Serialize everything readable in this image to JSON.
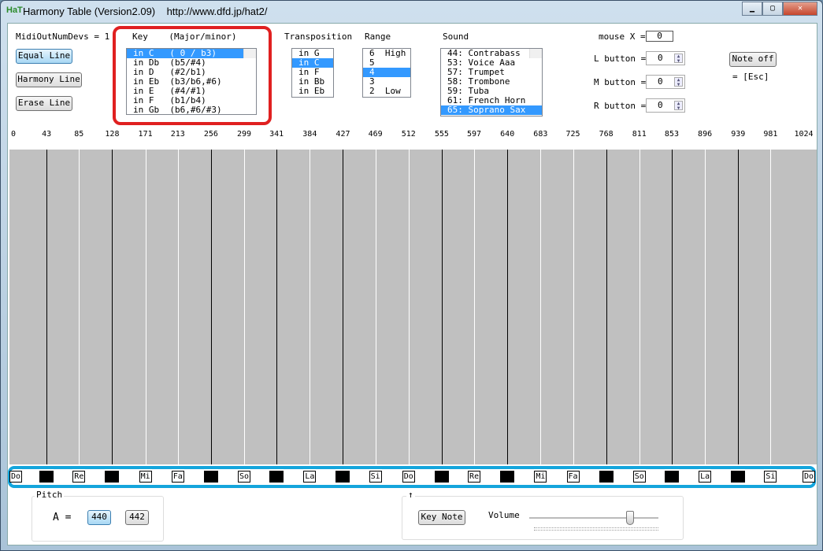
{
  "window": {
    "title": "Harmony Table (Version2.09)    http://www.dfd.jp/hat2/",
    "icon": "HaT"
  },
  "midi": {
    "label": "MidiOutNumDevs = 1"
  },
  "buttons": {
    "equal_line": "Equal Line",
    "harmony_line": "Harmony Line",
    "erase_line": "Erase Line",
    "note_off": "Note off",
    "esc": "= [Esc]",
    "key_note": "Key Note"
  },
  "key": {
    "label": "Key    (Major/minor)",
    "items": [
      "in C   ( 0 / b3)",
      "in Db  (b5/#4)",
      "in D   (#2/b1)",
      "in Eb  (b3/b6,#6)",
      "in E   (#4/#1)",
      "in F   (b1/b4)",
      "in Gb  (b6,#6/#3)"
    ],
    "selected": 0
  },
  "transposition": {
    "label": "Transposition",
    "items": [
      "in G",
      "in C",
      "in F",
      "in Bb",
      "in Eb"
    ],
    "selected": 1
  },
  "range": {
    "label": "Range",
    "items": [
      "6  High",
      "5",
      "4",
      "3",
      "2  Low"
    ],
    "selected": 2
  },
  "sound": {
    "label": "Sound",
    "items": [
      "44: Contrabass",
      "53: Voice Aaa",
      "57: Trumpet",
      "58: Trombone",
      "59: Tuba",
      "61: French Horn",
      "65: Soprano Sax"
    ],
    "selected": 6
  },
  "mouse": {
    "x_label": "mouse X =",
    "x_value": "0",
    "l_label": "L button =",
    "l_value": "0",
    "m_label": "M button =",
    "m_value": "0",
    "r_label": "R button =",
    "r_value": "0"
  },
  "ticks": [
    "0",
    "43",
    "85",
    "128",
    "171",
    "213",
    "256",
    "299",
    "341",
    "384",
    "427",
    "469",
    "512",
    "555",
    "597",
    "640",
    "683",
    "725",
    "768",
    "811",
    "853",
    "896",
    "939",
    "981",
    "1024"
  ],
  "notes": [
    "Do",
    "",
    "Re",
    "",
    "Mi",
    "Fa",
    "",
    "So",
    "",
    "La",
    "",
    "Si",
    "Do",
    "",
    "Re",
    "",
    "Mi",
    "Fa",
    "",
    "So",
    "",
    "La",
    "",
    "Si",
    "Do"
  ],
  "pitch": {
    "label": "Pitch",
    "a_label": "A =",
    "opt1": "440",
    "opt2": "442",
    "selected": "440"
  },
  "volume": {
    "group_label": "↑",
    "label": "Volume",
    "level": 0.78
  }
}
